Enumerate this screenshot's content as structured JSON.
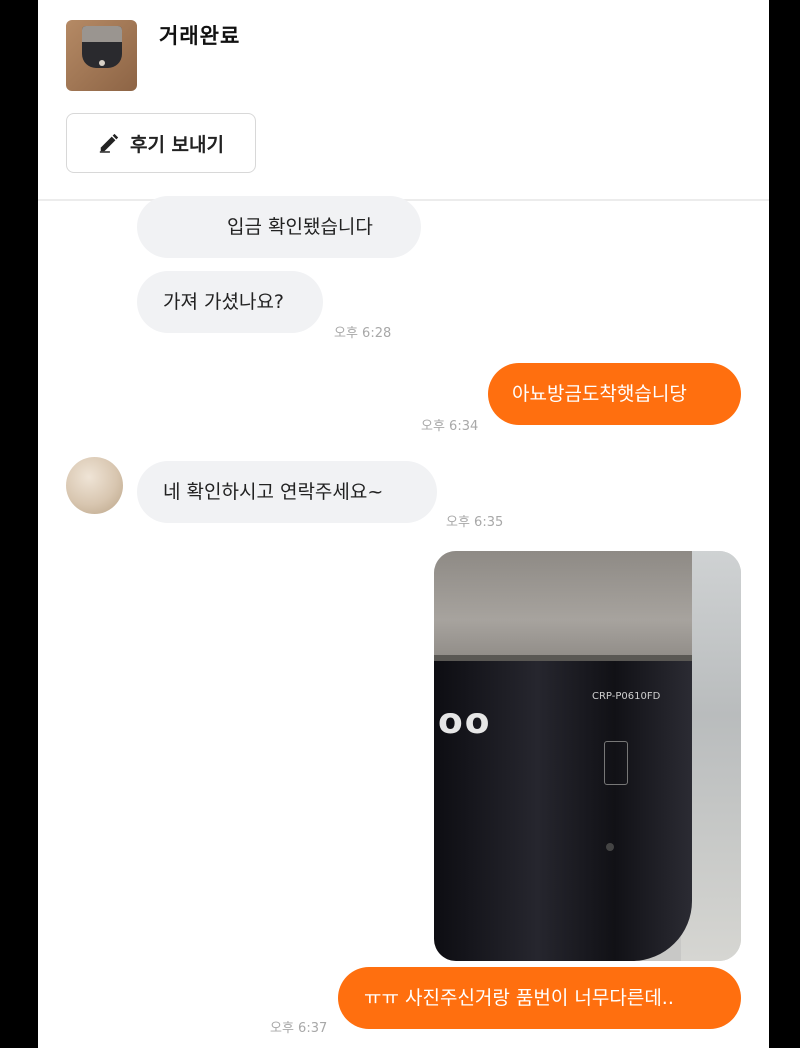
{
  "header": {
    "status": "거래완료",
    "review_button_label": "후기 보내기",
    "review_icon": "pencil-icon",
    "thumbnail_icon": "product-thumbnail"
  },
  "messages": [
    {
      "side": "in",
      "text": "입금 확인됐습니다",
      "time": ""
    },
    {
      "side": "in",
      "text": "가져 가셨나요?",
      "time": "오후 6:28"
    },
    {
      "side": "out",
      "text": "아뇨방금도착햇습니당",
      "time": "오후 6:34"
    },
    {
      "side": "in",
      "text": "네 확인하시고 연락주세요~",
      "time": "오후 6:35"
    },
    {
      "side": "out",
      "type": "image",
      "image_label": "rice-cooker-photo",
      "brand_text": "oo",
      "model_text": "CRP-P0610FD"
    },
    {
      "side": "out",
      "text": "ㅠㅠ 사진주신거랑 품번이 너무다른데..",
      "time": "오후 6:37"
    }
  ],
  "colors": {
    "accent": "#ff6f0f",
    "incoming_bubble": "#f1f2f4",
    "background": "#ffffff"
  }
}
